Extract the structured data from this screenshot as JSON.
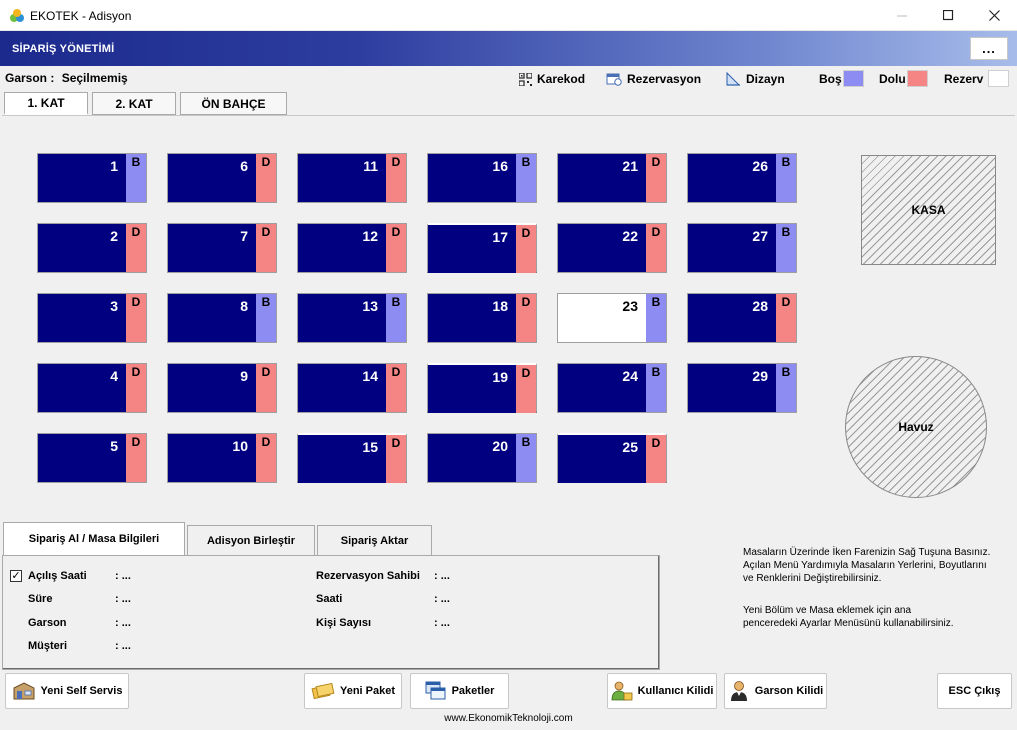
{
  "window": {
    "title": "EKOTEK - Adisyon",
    "minimize": "—",
    "maximize": "☐",
    "close": "✕"
  },
  "header": {
    "title": "SİPARİŞ YÖNETİMİ",
    "menu_label": "..."
  },
  "garson": {
    "label": "Garson :",
    "value": "Seçilmemiş"
  },
  "toolbar": {
    "karekod": "Karekod",
    "rezervasyon": "Rezervasyon",
    "dizayn": "Dizayn"
  },
  "legend": [
    {
      "label": "Boş",
      "color": "#8c8cf2"
    },
    {
      "label": "Dolu",
      "color": "#f58484"
    },
    {
      "label": "Rezerv",
      "color": "#ffffff"
    }
  ],
  "floor_tabs": [
    "1. KAT",
    "2. KAT",
    "ÖN BAHÇE"
  ],
  "active_floor": "1. KAT",
  "status_colors": {
    "B": "#8c8cf2",
    "D": "#f58484"
  },
  "tables": [
    {
      "num": "1",
      "status": "B"
    },
    {
      "num": "6",
      "status": "D"
    },
    {
      "num": "11",
      "status": "D"
    },
    {
      "num": "16",
      "status": "B"
    },
    {
      "num": "21",
      "status": "D"
    },
    {
      "num": "26",
      "status": "B"
    },
    {
      "num": "2",
      "status": "D"
    },
    {
      "num": "7",
      "status": "D"
    },
    {
      "num": "12",
      "status": "D"
    },
    {
      "num": "17",
      "status": "D"
    },
    {
      "num": "22",
      "status": "D"
    },
    {
      "num": "27",
      "status": "B"
    },
    {
      "num": "3",
      "status": "D"
    },
    {
      "num": "8",
      "status": "B"
    },
    {
      "num": "13",
      "status": "B"
    },
    {
      "num": "18",
      "status": "D"
    },
    {
      "num": "23",
      "status": "B",
      "selected": true
    },
    {
      "num": "28",
      "status": "D"
    },
    {
      "num": "4",
      "status": "D"
    },
    {
      "num": "9",
      "status": "D"
    },
    {
      "num": "14",
      "status": "D"
    },
    {
      "num": "19",
      "status": "D"
    },
    {
      "num": "24",
      "status": "B"
    },
    {
      "num": "29",
      "status": "B"
    },
    {
      "num": "5",
      "status": "D"
    },
    {
      "num": "10",
      "status": "D"
    },
    {
      "num": "15",
      "status": "D"
    },
    {
      "num": "20",
      "status": "B"
    },
    {
      "num": "25",
      "status": "D"
    }
  ],
  "areas": {
    "kasa": "KASA",
    "havuz": "Havuz"
  },
  "bottom_tabs": [
    "Sipariş Al / Masa Bilgileri",
    "Adisyon Birleştir",
    "Sipariş Aktar"
  ],
  "info": {
    "acilis_saati": {
      "label": "Açılış Saati",
      "value": ": ..."
    },
    "sure": {
      "label": "Süre",
      "value": ": ..."
    },
    "garson": {
      "label": "Garson",
      "value": ": ..."
    },
    "musteri": {
      "label": "Müşteri",
      "value": ": ..."
    },
    "rezervasyon_sahibi": {
      "label": "Rezervasyon Sahibi",
      "value": ": ..."
    },
    "saati": {
      "label": "Saati",
      "value": ": ..."
    },
    "kisi_sayisi": {
      "label": "Kişi Sayısı",
      "value": ": ..."
    },
    "acilis_checked": "✓"
  },
  "help": {
    "line1": "Masaların Üzerinde İken Farenizin Sağ Tuşuna Basınız.",
    "line2": "Açılan Menü Yardımıyla Masaların Yerlerini, Boyutlarını",
    "line3": "ve Renklerini  Değiştirebilirsiniz.",
    "line4": "Yeni Bölüm ve Masa eklemek için ana",
    "line5": "penceredeki Ayarlar Menüsünü kullanabilirsiniz."
  },
  "buttons": {
    "yeni_self_servis": "Yeni Self Servis",
    "yeni_paket": "Yeni Paket",
    "paketler": "Paketler",
    "kullanici_kilidi": "Kullanıcı Kilidi",
    "garson_kilidi": "Garson Kilidi",
    "esc_cikis": "ESC Çıkış"
  },
  "footer": "www.EkonomikTeknoloji.com"
}
